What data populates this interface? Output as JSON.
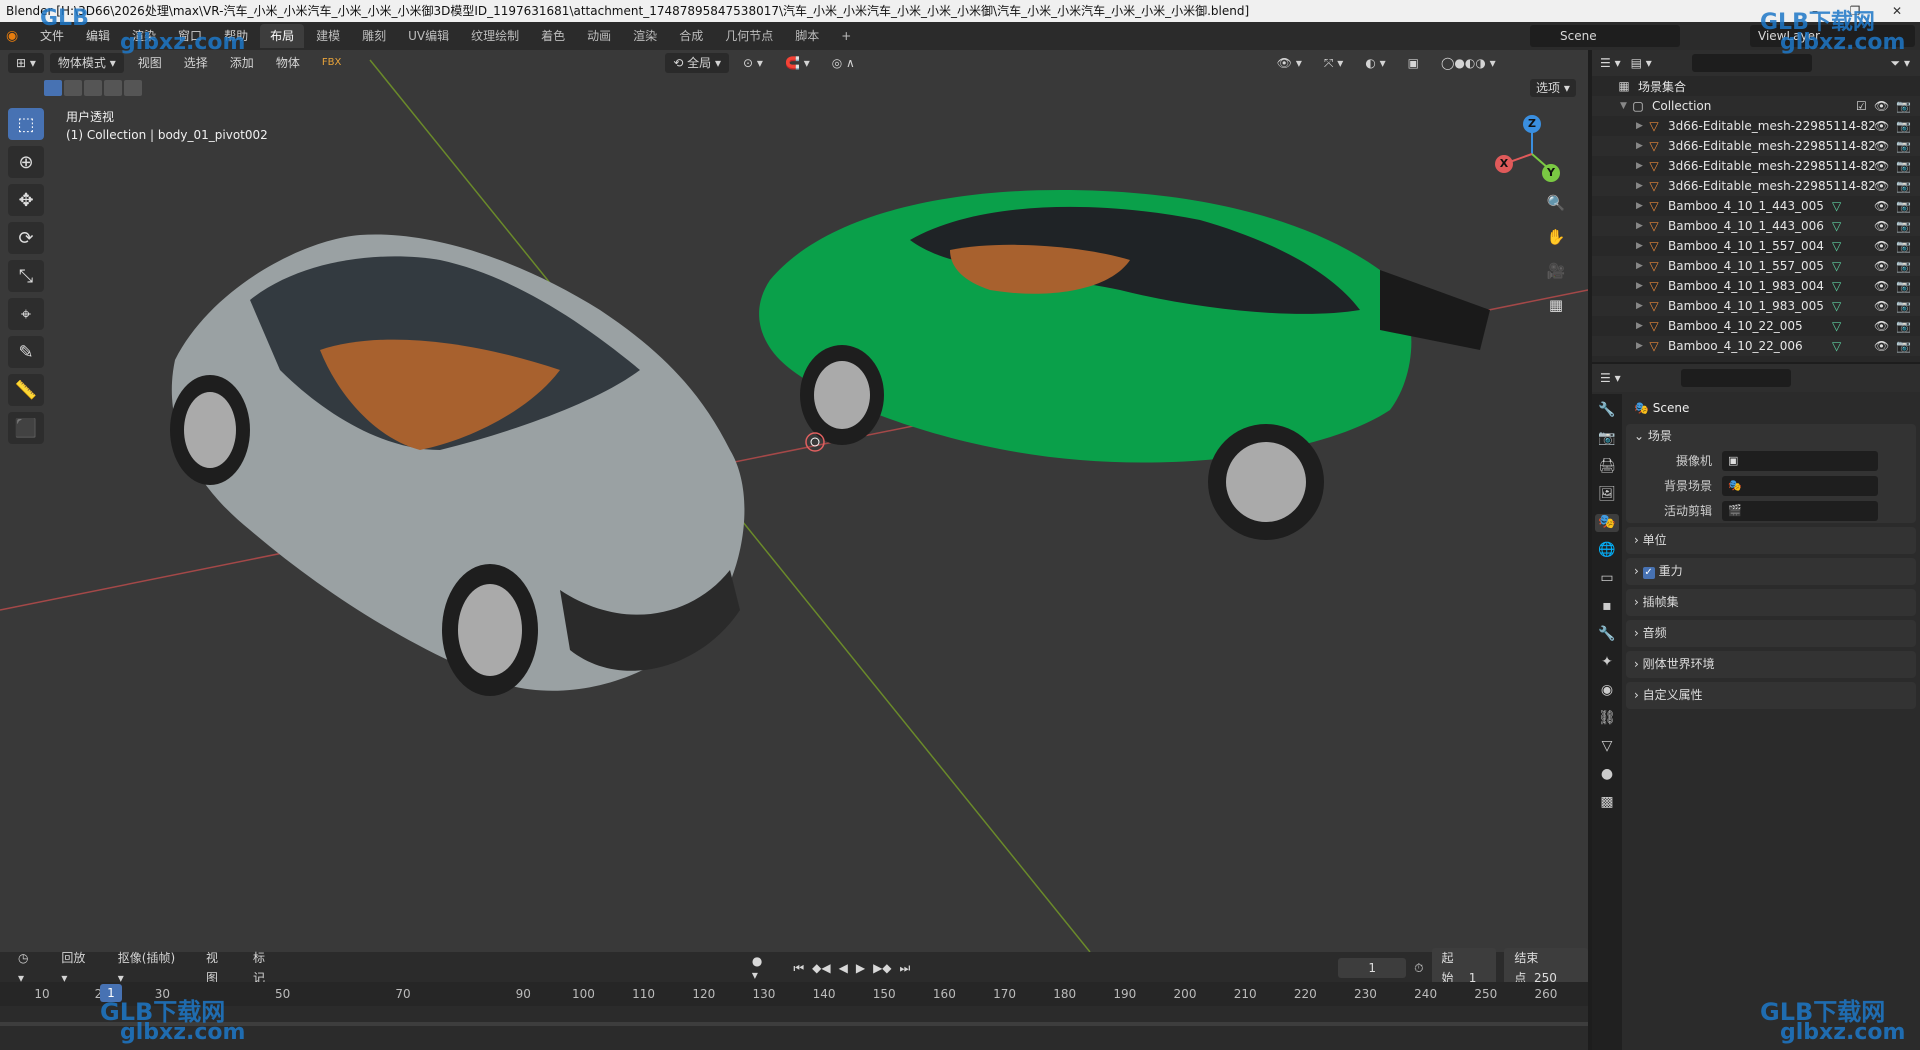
{
  "window": {
    "title": "Blender [H:\\3D66\\2026处理\\max\\VR-汽车_小米_小米汽车_小米_小米_小米御3D模型ID_1197631681\\attachment_17487895847538017\\汽车_小米_小米汽车_小米_小米_小米御\\汽车_小米_小米汽车_小米_小米_小米御.blend]",
    "minimize": "–",
    "maximize": "❐",
    "close": "✕"
  },
  "menu": [
    "文件",
    "编辑",
    "渲染",
    "窗口",
    "帮助"
  ],
  "workspaces": [
    "布局",
    "建模",
    "雕刻",
    "UV编辑",
    "纹理绘制",
    "着色",
    "动画",
    "渲染",
    "合成",
    "几何节点",
    "脚本",
    "+"
  ],
  "active_workspace": "布局",
  "scene_name": "Scene",
  "view_layer": "ViewLayer",
  "viewport": {
    "mode": "物体模式",
    "menus": [
      "视图",
      "选择",
      "添加",
      "物体"
    ],
    "transform_orientation": "全局",
    "options": "选项",
    "perspective_label": "用户透视",
    "object_info": "(1) Collection | body_01_pivot002",
    "gizmo": {
      "x": "X",
      "y": "Y",
      "z": "Z"
    }
  },
  "tools": [
    "select",
    "cursor",
    "move",
    "rotate",
    "scale",
    "transform",
    "annotate",
    "measure",
    "add-cube"
  ],
  "timeline": {
    "playback": "回放",
    "keying": "抠像(插帧)",
    "view": "视图",
    "marker": "标记",
    "current_frame": "1",
    "start_label": "起始",
    "start": "1",
    "end_label": "结束点",
    "end": "250",
    "cursor_frame": "1",
    "ticks": [
      "10",
      "20",
      "30",
      "50",
      "70",
      "90",
      "100",
      "110",
      "120",
      "130",
      "140",
      "150",
      "160",
      "170",
      "180",
      "190",
      "200",
      "210",
      "220",
      "230",
      "240",
      "250",
      "260"
    ]
  },
  "outliner": {
    "root": "场景集合",
    "collection": "Collection",
    "items": [
      {
        "name": "3d66-Editable_mesh-22985114-82",
        "modifier": false
      },
      {
        "name": "3d66-Editable_mesh-22985114-82",
        "modifier": false
      },
      {
        "name": "3d66-Editable_mesh-22985114-82",
        "modifier": false
      },
      {
        "name": "3d66-Editable_mesh-22985114-82",
        "modifier": false
      },
      {
        "name": "Bamboo_4_10_1_443_005",
        "modifier": true
      },
      {
        "name": "Bamboo_4_10_1_443_006",
        "modifier": true
      },
      {
        "name": "Bamboo_4_10_1_557_004",
        "modifier": true
      },
      {
        "name": "Bamboo_4_10_1_557_005",
        "modifier": true
      },
      {
        "name": "Bamboo_4_10_1_983_004",
        "modifier": true
      },
      {
        "name": "Bamboo_4_10_1_983_005",
        "modifier": true
      },
      {
        "name": "Bamboo_4_10_22_005",
        "modifier": true
      },
      {
        "name": "Bamboo_4_10_22_006",
        "modifier": true
      }
    ]
  },
  "properties": {
    "context": "Scene",
    "scene_panel": "场景",
    "camera_label": "摄像机",
    "background_label": "背景场景",
    "clip_label": "活动剪辑",
    "panels": [
      "单位",
      "重力",
      "插帧集",
      "音频",
      "刚体世界环境",
      "自定义属性"
    ]
  },
  "watermark": {
    "logo": "GLB下载网",
    "url": "glbxz.com",
    "short": "GLB"
  },
  "colors": {
    "accent": "#4772b3",
    "x_axis": "#e05a5a",
    "y_axis": "#7ac943",
    "z_axis": "#3a8fe0",
    "car_green": "#0aa04a"
  }
}
